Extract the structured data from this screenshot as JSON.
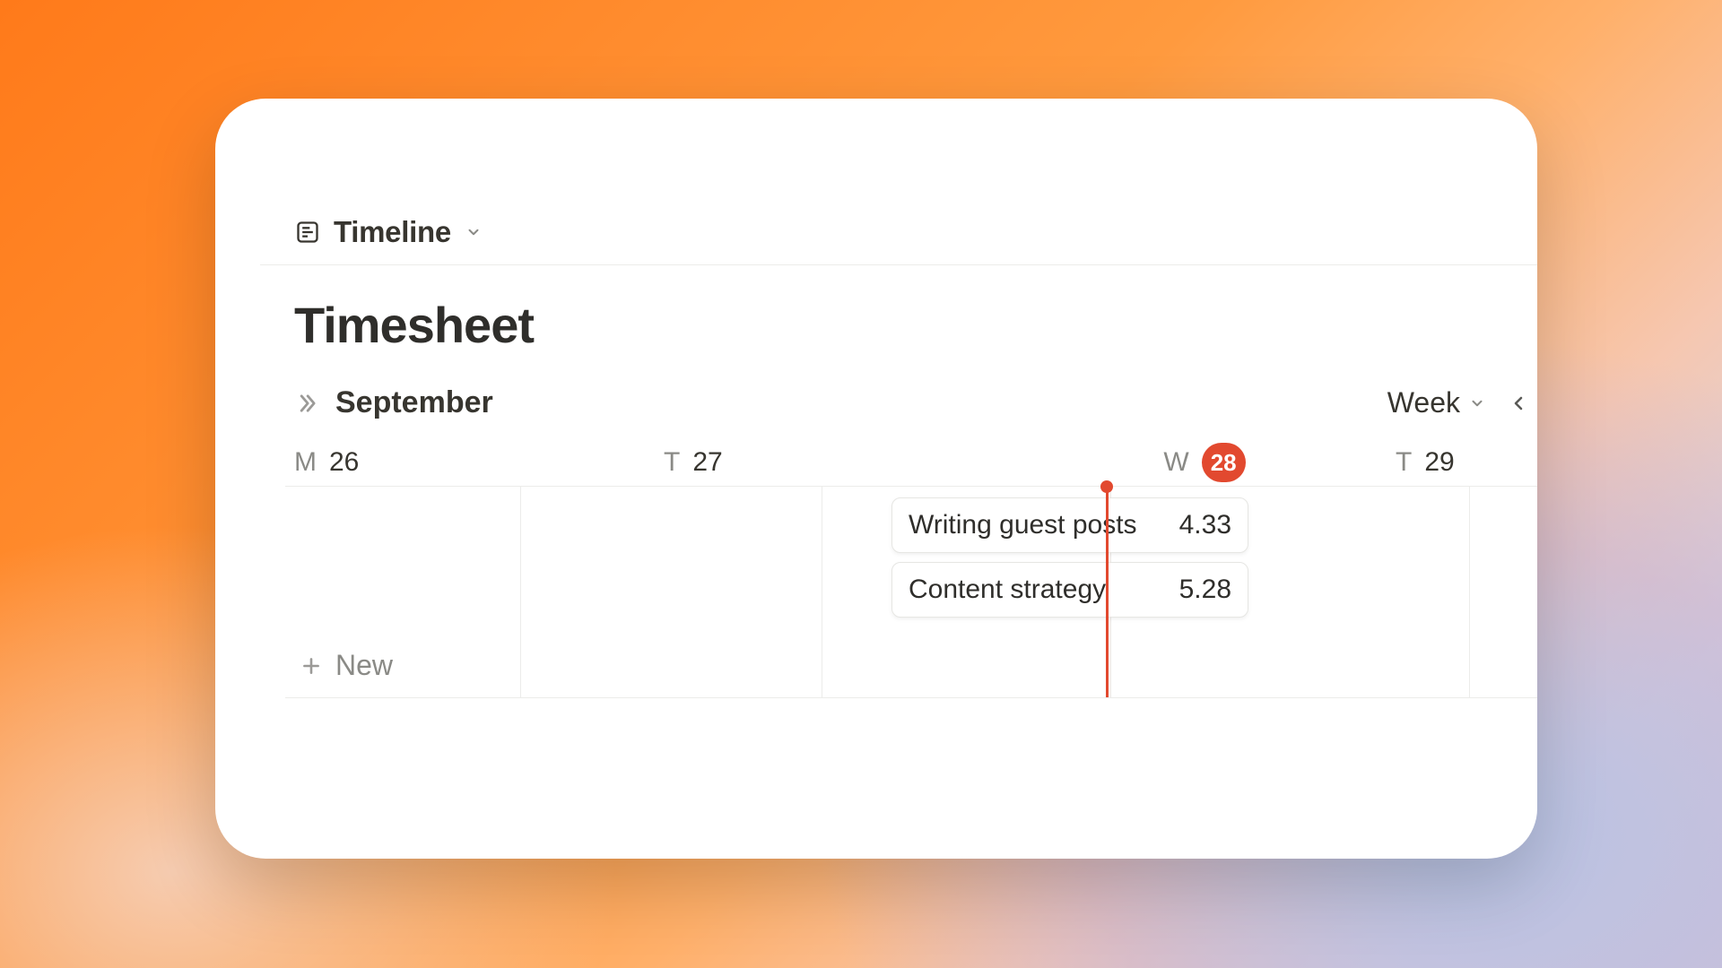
{
  "view": {
    "label": "Timeline"
  },
  "title": "Timesheet",
  "month": {
    "label": "September"
  },
  "range": {
    "label": "Week"
  },
  "days": [
    {
      "dow": "M",
      "num": "26",
      "today": false
    },
    {
      "dow": "T",
      "num": "27",
      "today": false
    },
    {
      "dow": "W",
      "num": "28",
      "today": true
    },
    {
      "dow": "T",
      "num": "29",
      "today": false
    }
  ],
  "entries": [
    {
      "title": "Writing guest posts",
      "value": "4.33"
    },
    {
      "title": "Content strategy",
      "value": "5.28"
    }
  ],
  "new_label": "New"
}
